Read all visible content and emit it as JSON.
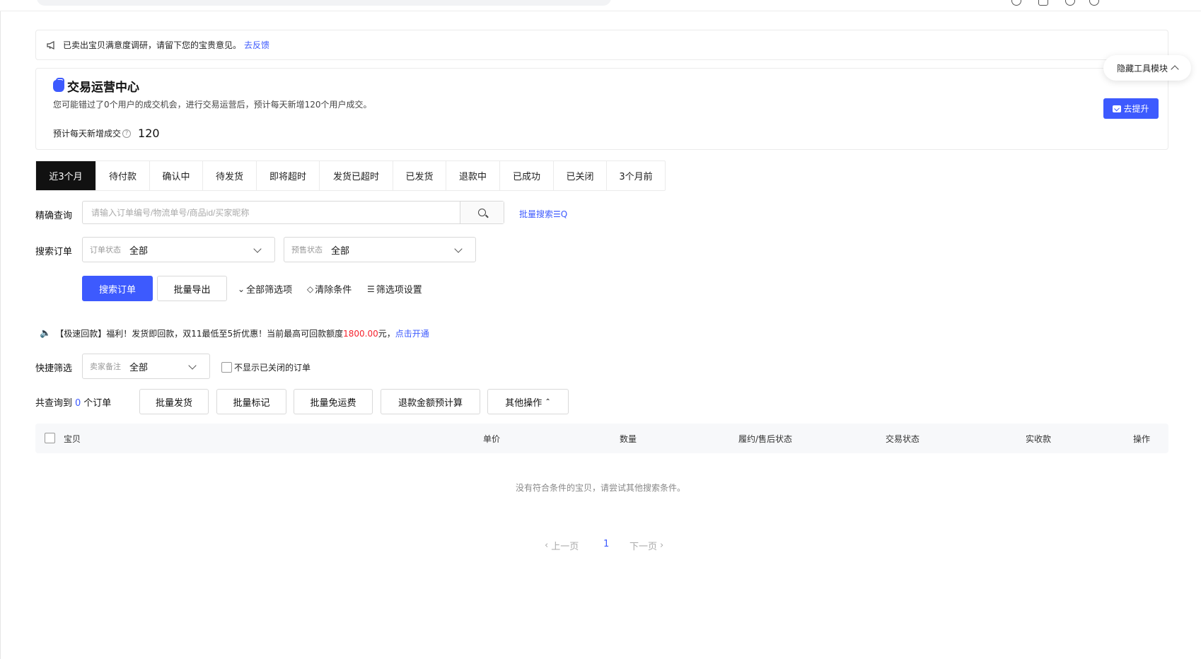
{
  "notice": {
    "text": "已卖出宝贝满意度调研，请留下您的宝贵意见。",
    "link": "去反馈"
  },
  "hide_tools": "隐藏工具模块",
  "trade_center": {
    "title": "交易运营中心",
    "desc": "您可能错过了0个用户的成交机会，进行交易运营后，预计每天新增120个用户成交。",
    "est_label": "预计每天新增成交",
    "est_value": "120",
    "button": "去提升"
  },
  "tabs": [
    "近3个月",
    "待付款",
    "确认中",
    "待发货",
    "即将超时",
    "发货已超时",
    "已发货",
    "退款中",
    "已成功",
    "已关闭",
    "3个月前"
  ],
  "exact_search": {
    "label": "精确查询",
    "placeholder": "请输入订单编号/物流单号/商品id/买家昵称",
    "batch": "批量搜索"
  },
  "search_orders": {
    "label": "搜索订单",
    "order_status": {
      "label": "订单状态",
      "value": "全部"
    },
    "presale_status": {
      "label": "预售状态",
      "value": "全部"
    }
  },
  "actions": {
    "search": "搜索订单",
    "export": "批量导出",
    "all_filters": "全部筛选项",
    "clear": "清除条件",
    "filter_settings": "筛选项设置"
  },
  "promo": {
    "prefix": "【极速回款】福利！发货即回款，双11最低至5折优惠！当前最高可回款额度",
    "amount": "1800.00",
    "suffix": "元，",
    "link": "点击开通"
  },
  "quick_filter": {
    "label": "快捷筛选",
    "remark": {
      "label": "卖家备注",
      "value": "全部"
    },
    "hide_closed": "不显示已关闭的订单"
  },
  "summary": {
    "prefix": "共查询到",
    "count": "0",
    "suffix": "个订单"
  },
  "bulk_buttons": {
    "ship": "批量发货",
    "mark": "批量标记",
    "free_shipping": "批量免运费",
    "refund_calc": "退款金额预计算",
    "other": "其他操作"
  },
  "table": {
    "columns": [
      "宝贝",
      "单价",
      "数量",
      "履约/售后状态",
      "交易状态",
      "实收款",
      "操作"
    ],
    "empty": "没有符合条件的宝贝，请尝试其他搜索条件。"
  },
  "pagination": {
    "prev": "上一页",
    "current": "1",
    "next": "下一页"
  }
}
